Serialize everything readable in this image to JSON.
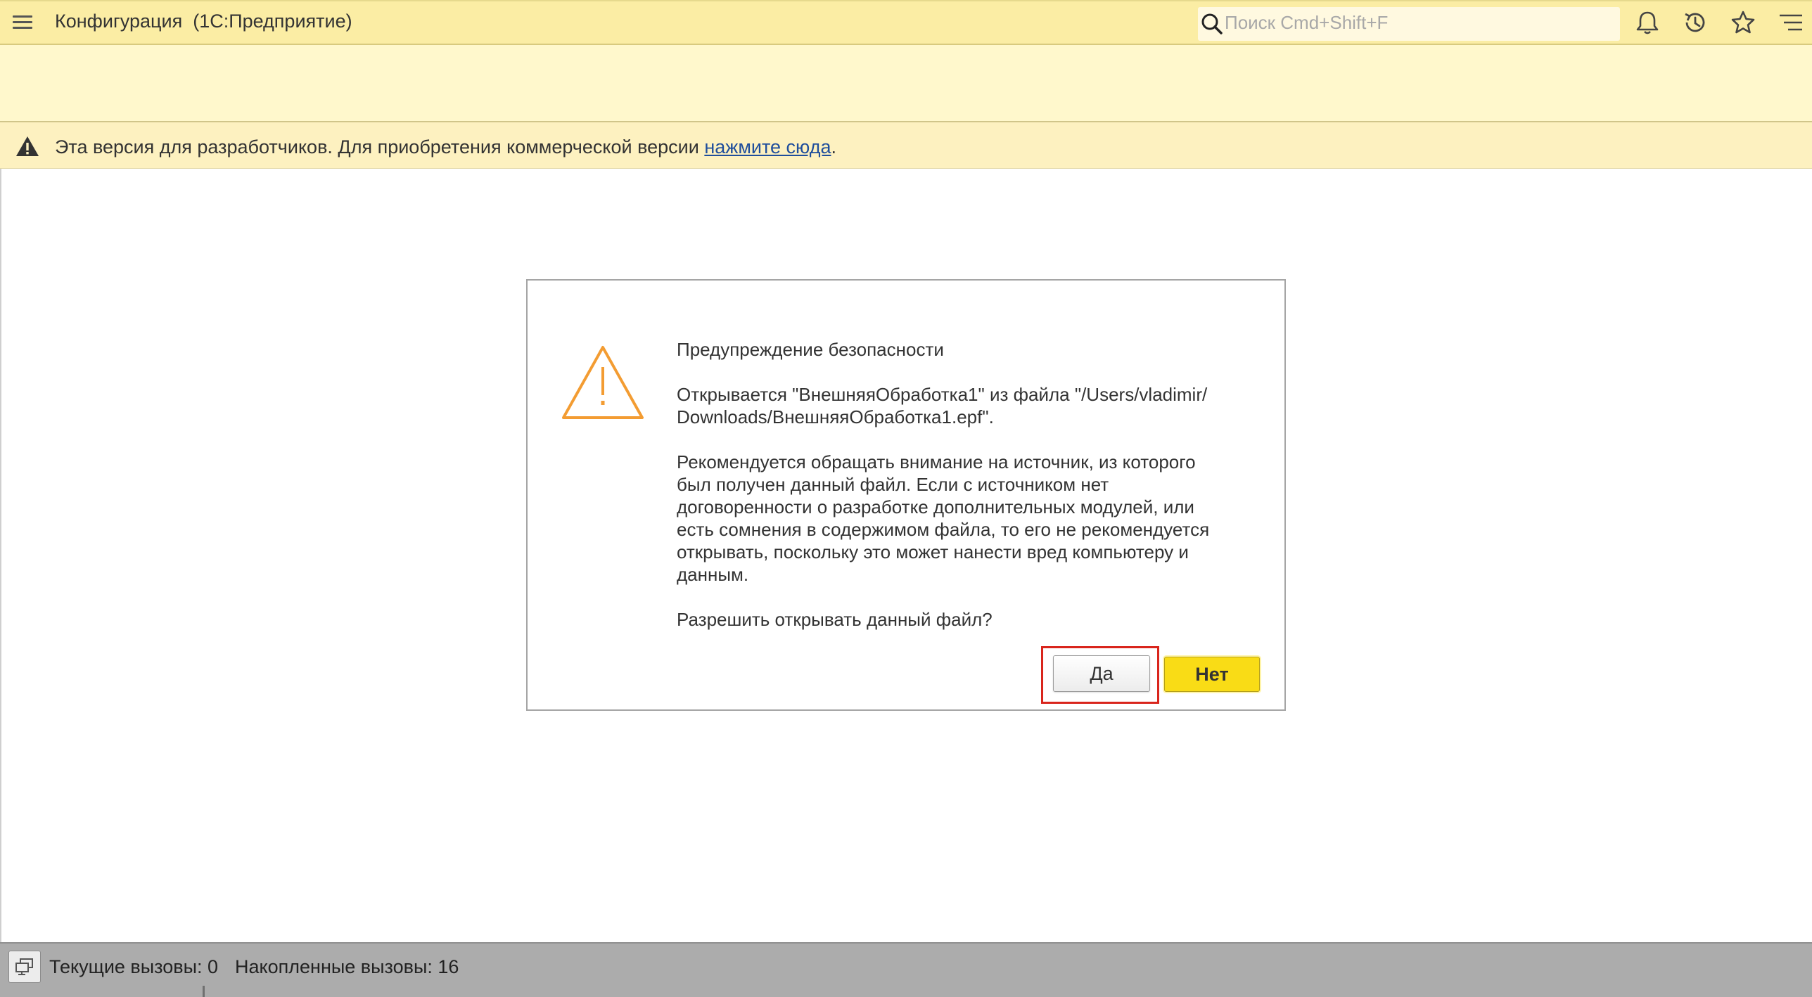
{
  "header": {
    "app_title": "Конфигурация  (1С:Предприятие)",
    "search_placeholder": "Поиск Cmd+Shift+F",
    "icons": [
      "menu-icon",
      "search-icon",
      "bell-icon",
      "history-icon",
      "star-icon",
      "menu-lines-icon"
    ]
  },
  "banner": {
    "text": "Эта версия для разработчиков. Для приобретения коммерческой версии ",
    "link": "нажмите сюда",
    "suffix": ".",
    "icon": "warning-icon"
  },
  "dialog": {
    "icon": "warning-triangle-icon",
    "title": "Предупреждение безопасности",
    "file_line1": "Открывается \"ВнешняяОбработка1\" из файла \"/Users/vladimir/",
    "file_line2": "Downloads/ВнешняяОбработка1.epf\".",
    "body_lines": [
      "Рекомендуется обращать внимание на источник, из которого",
      "был получен данный файл. Если с источником нет",
      "договоренности о разработке дополнительных модулей, или",
      "есть сомнения в содержимом файла, то его не рекомендуется",
      "открывать, поскольку это может нанести вред компьютеру и",
      "данным."
    ],
    "question": "Разрешить открывать данный файл?",
    "yes_label": "Да",
    "no_label": "Нет"
  },
  "status": {
    "current_calls": "Текущие вызовы: 0",
    "accumulated_calls": "Накопленные вызовы: 16",
    "icon": "monitor-icon"
  },
  "colors": {
    "topbar": "#fbeda4",
    "panel": "#fff8cc",
    "banner": "#fdf1c0",
    "warning": "#f39c32",
    "no_button": "#f9dc16",
    "highlight": "#d9251c",
    "statusbar": "#acacac",
    "link": "#1f4e9c"
  }
}
